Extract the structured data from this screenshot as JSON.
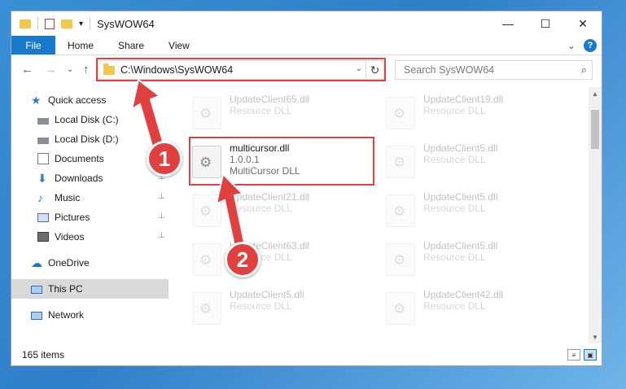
{
  "window": {
    "title": "SysWOW64",
    "controls": {
      "minimize": "—",
      "maximize": "☐",
      "close": "✕"
    }
  },
  "ribbon": {
    "file_tab": "File",
    "tabs": [
      "Home",
      "Share",
      "View"
    ],
    "expand": "⌄",
    "help": "?"
  },
  "address": {
    "path": "C:\\Windows\\SysWOW64",
    "refresh": "↻",
    "dropdown": "⌄"
  },
  "search": {
    "placeholder": "Search SysWOW64",
    "icon": "⌕"
  },
  "nav": {
    "back": "←",
    "forward": "→",
    "recent": "⌄",
    "up": "↑",
    "items": [
      {
        "label": "Quick access",
        "icon": "star-icon"
      },
      {
        "label": "Local Disk (C:)",
        "icon": "drive-icon"
      },
      {
        "label": "Local Disk (D:)",
        "icon": "drive-icon"
      },
      {
        "label": "Documents",
        "icon": "documents-icon"
      },
      {
        "label": "Downloads",
        "icon": "downloads-icon"
      },
      {
        "label": "Music",
        "icon": "music-icon"
      },
      {
        "label": "Pictures",
        "icon": "pictures-icon"
      },
      {
        "label": "Videos",
        "icon": "videos-icon"
      },
      {
        "label": "OneDrive",
        "icon": "cloud-icon"
      },
      {
        "label": "This PC",
        "icon": "computer-icon"
      },
      {
        "label": "Network",
        "icon": "network-icon"
      }
    ],
    "pin": "📌"
  },
  "files": [
    {
      "name": "UpdateClient65.dll",
      "desc": "Resource DLL"
    },
    {
      "name": "UpdateClient19.dll",
      "desc": "Resource DLL"
    },
    {
      "name": "multicursor.dll",
      "version": "1.0.0.1",
      "desc": "MultiCursor DLL"
    },
    {
      "name": "UpdateClient5.dll",
      "desc": "Resource DLL"
    },
    {
      "name": "UpdateClient21.dll",
      "desc": "Resource DLL"
    },
    {
      "name": "UpdateClient5.dll",
      "desc": "Resource DLL"
    },
    {
      "name": "UpdateClient63.dll",
      "desc": "Resource DLL"
    },
    {
      "name": "UpdateClient5.dll",
      "desc": "Resource DLL"
    },
    {
      "name": "UpdateClient5.dll",
      "desc": "Resource DLL"
    },
    {
      "name": "UpdateClient42.dll",
      "desc": "Resource DLL"
    }
  ],
  "status": {
    "count": "165 items"
  },
  "annotations": {
    "badge1": "1",
    "badge2": "2"
  },
  "colors": {
    "accent": "#1979ca",
    "highlight": "#e04040"
  }
}
